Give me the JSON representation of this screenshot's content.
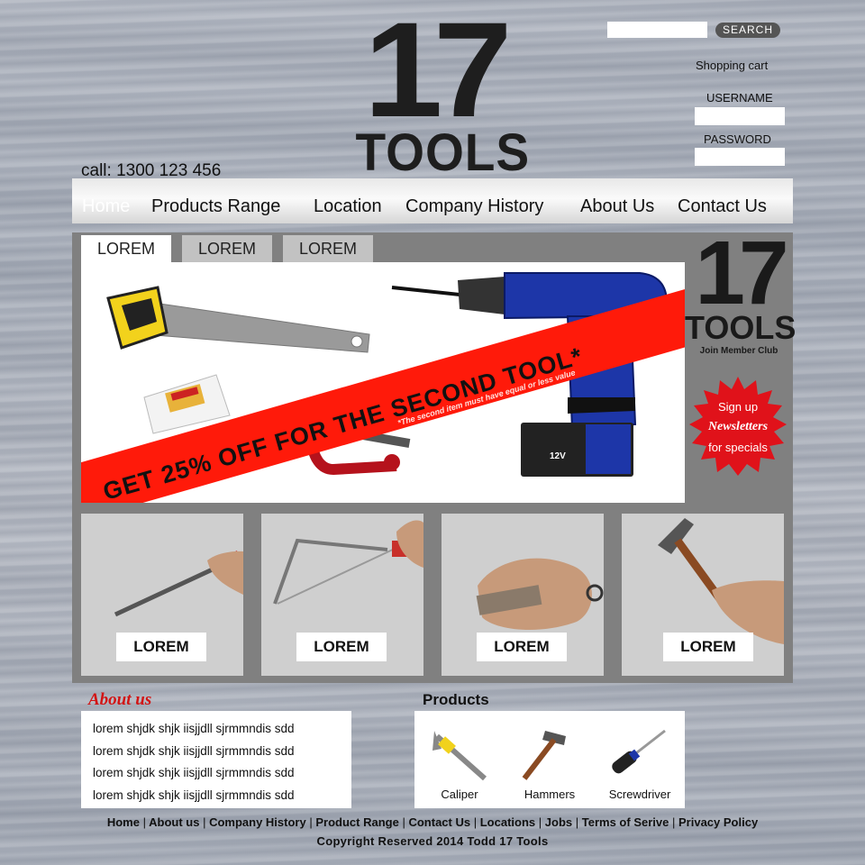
{
  "header": {
    "logo_number": "17",
    "logo_word": "TOOLS",
    "phone": "call: 1300 123 456"
  },
  "account": {
    "search_button": "SEARCH",
    "shopping_cart": "Shopping cart",
    "username_label": "USERNAME",
    "password_label": "PASSWORD"
  },
  "nav": {
    "items": [
      {
        "label": "Home",
        "active": true
      },
      {
        "label": "Products Range"
      },
      {
        "label": "Location"
      },
      {
        "label": "Company History"
      },
      {
        "label": "About Us"
      },
      {
        "label": "Contact Us"
      }
    ]
  },
  "tabs": [
    {
      "label": "LOREM",
      "active": true
    },
    {
      "label": "LOREM"
    },
    {
      "label": "LOREM"
    }
  ],
  "banner": {
    "headline": "GET 25% OFF FOR THE SECOND TOOL*",
    "footnote": "*The second item must have equal or less value",
    "battery_label": "12V"
  },
  "side_logo": {
    "number": "17",
    "word": "TOOLS",
    "tagline": "Join Member Club"
  },
  "newsletter": {
    "line1": "Sign up",
    "line2": "Newsletters",
    "line3": "for specials"
  },
  "thumbnails": [
    {
      "label": "LOREM",
      "icon": "screwdriver-in-hand"
    },
    {
      "label": "LOREM",
      "icon": "hacksaw-in-hand"
    },
    {
      "label": "LOREM",
      "icon": "knife-in-hand"
    },
    {
      "label": "LOREM",
      "icon": "hammer-in-hand"
    }
  ],
  "about": {
    "title": "About us",
    "lines": [
      "lorem shjdk shjk iisjjdll sjrmmndis sdd",
      "lorem shjdk shjk iisjjdll sjrmmndis sdd",
      "lorem shjdk shjk iisjjdll sjrmmndis sdd",
      "lorem shjdk shjk iisjjdll sjrmmndis sdd"
    ]
  },
  "products": {
    "title": "Products",
    "items": [
      {
        "label": "Caliper",
        "icon": "caliper-icon"
      },
      {
        "label": "Hammers",
        "icon": "hammer-icon"
      },
      {
        "label": "Screwdriver",
        "icon": "screwdriver-icon"
      }
    ]
  },
  "footer": {
    "links": [
      "Home",
      "About us",
      "Company History",
      "Product Range",
      "Contact Us",
      "Locations",
      "Jobs",
      "Terms of Serive",
      "Privacy Policy"
    ],
    "separator": "|",
    "copyright": "Copyright Reserved 2014 Todd 17 Tools"
  },
  "colors": {
    "banner_red": "#ff1a0a",
    "badge_red": "#e0121a",
    "about_title_red": "#d21414",
    "panel_gray": "#808080"
  }
}
